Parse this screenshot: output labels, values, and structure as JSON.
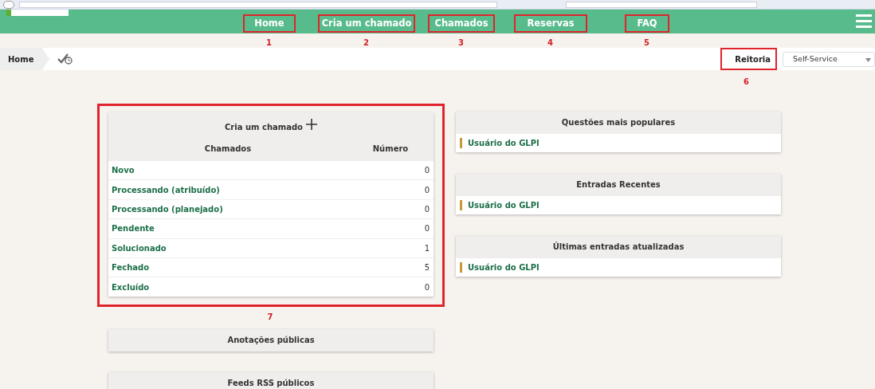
{
  "navbar": {
    "items": [
      {
        "label": "Home",
        "callout": "1"
      },
      {
        "label": "Cria um chamado",
        "callout": "2"
      },
      {
        "label": "Chamados",
        "callout": "3"
      },
      {
        "label": "Reservas",
        "callout": "4"
      },
      {
        "label": "FAQ",
        "callout": "5"
      }
    ]
  },
  "breadcrumb": {
    "items": [
      "Home"
    ]
  },
  "entity": {
    "label": "Reitoria",
    "callout": "6"
  },
  "profile_select": {
    "value": "Self-Service"
  },
  "tickets_card": {
    "title": "Cria um chamado",
    "callout": "7",
    "columns": [
      "Chamados",
      "Número"
    ],
    "rows": [
      {
        "status": "Novo",
        "count": "0"
      },
      {
        "status": "Processando (atribuído)",
        "count": "0"
      },
      {
        "status": "Processando (planejado)",
        "count": "0"
      },
      {
        "status": "Pendente",
        "count": "0"
      },
      {
        "status": "Solucionado",
        "count": "1"
      },
      {
        "status": "Fechado",
        "count": "5"
      },
      {
        "status": "Excluído",
        "count": "0"
      }
    ]
  },
  "left_panels": [
    {
      "title": "Anotações públicas"
    },
    {
      "title": "Feeds RSS públicos"
    }
  ],
  "right_panels": [
    {
      "title": "Questões mais populares",
      "items": [
        "Usuário do GLPI"
      ]
    },
    {
      "title": "Entradas Recentes",
      "items": [
        "Usuário do GLPI"
      ]
    },
    {
      "title": "Últimas entradas atualizadas",
      "items": [
        "Usuário do GLPI"
      ]
    }
  ]
}
